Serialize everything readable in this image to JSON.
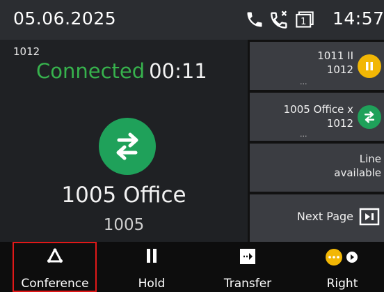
{
  "statusbar": {
    "date": "05.06.2025",
    "time": "14:57",
    "icons": [
      "phone-icon",
      "missed-call-icon",
      "line-1-icon"
    ],
    "line_icon_number": "1"
  },
  "main": {
    "line_number": "1012",
    "status": "Connected",
    "duration": "00:11",
    "avatar_icon": "transfer-arrows-icon",
    "avatar_color": "#1fa15a",
    "contact_name": "1005 Office",
    "contact_number": "1005"
  },
  "lines": [
    {
      "line1": "1011 II",
      "line2": "1012",
      "dots": "...",
      "badge_icon": "pause-icon",
      "badge_color": "#f2b705"
    },
    {
      "line1": "1005 Office x",
      "line2": "1012",
      "dots": "...",
      "badge_icon": "transfer-arrows-icon",
      "badge_color": "#1fa15a"
    },
    {
      "line1": "Line",
      "line2": "available"
    },
    {
      "line1": "Next Page",
      "badge_icon": "next-page-icon"
    }
  ],
  "softkeys": [
    {
      "label": "Conference",
      "icon": "conference-icon"
    },
    {
      "label": "Hold",
      "icon": "pause-icon"
    },
    {
      "label": "Transfer",
      "icon": "transfer-icon"
    },
    {
      "label": "Right",
      "icon": "more-icon"
    }
  ],
  "colors": {
    "connected": "#37b24d",
    "highlight": "#e01818"
  }
}
